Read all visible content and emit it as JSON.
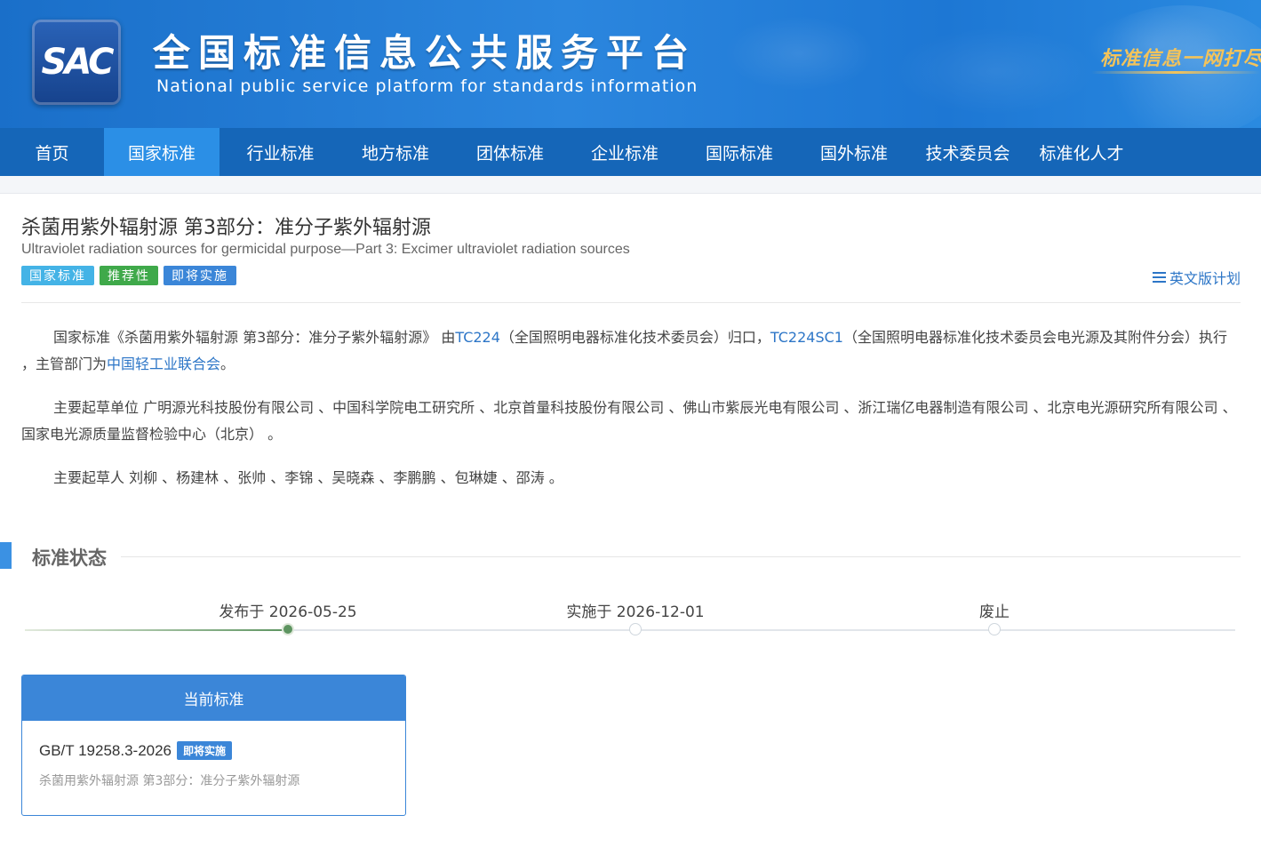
{
  "header": {
    "logo_text": "SAC",
    "title_cn": "全国标准信息公共服务平台",
    "title_en": "National public service platform  for standards information",
    "slogan": "标准信息一网打尽"
  },
  "nav": {
    "items": [
      {
        "label": "首页",
        "active": false
      },
      {
        "label": "国家标准",
        "active": true
      },
      {
        "label": "行业标准",
        "active": false
      },
      {
        "label": "地方标准",
        "active": false
      },
      {
        "label": "团体标准",
        "active": false
      },
      {
        "label": "企业标准",
        "active": false
      },
      {
        "label": "国际标准",
        "active": false
      },
      {
        "label": "国外标准",
        "active": false
      },
      {
        "label": "技术委员会",
        "active": false
      },
      {
        "label": "标准化人才",
        "active": false
      }
    ]
  },
  "standard": {
    "title_cn": "杀菌用紫外辐射源 第3部分：准分子紫外辐射源",
    "title_en": "Ultraviolet radiation sources for germicidal purpose—Part 3: Excimer ultraviolet radiation sources",
    "tags": [
      "国家标准",
      "推荐性",
      "即将实施"
    ],
    "en_plan_label": "英文版计划"
  },
  "description": {
    "p1_a": "国家标准《杀菌用紫外辐射源 第3部分：准分子紫外辐射源》 由",
    "p1_tc": "TC224",
    "p1_b": "（全国照明电器标准化技术委员会）归口，",
    "p1_sc": "TC224SC1",
    "p1_c": "（全国照明电器标准化技术委员会电光源及其附件分会）执行 ，主管部门为",
    "p1_dept": "中国轻工业联合会",
    "p1_end": "。",
    "p2": "主要起草单位 广明源光科技股份有限公司 、中国科学院电工研究所 、北京首量科技股份有限公司 、佛山市紫辰光电有限公司 、浙江瑞亿电器制造有限公司 、北京电光源研究所有限公司 、国家电光源质量监督检验中心（北京） 。",
    "p3": "主要起草人 刘柳 、杨建林 、张帅 、李锦 、吴晓森 、李鹏鹏 、包琳婕 、邵涛 。"
  },
  "status": {
    "section_title": "标准状态",
    "steps": [
      {
        "label": "发布于 2026-05-25",
        "done": true
      },
      {
        "label": "实施于 2026-12-01",
        "done": false
      },
      {
        "label": "废止",
        "done": false
      }
    ]
  },
  "current": {
    "header": "当前标准",
    "code": "GB/T 19258.3-2026",
    "badge": "即将实施",
    "name": "杀菌用紫外辐射源 第3部分：准分子紫外辐射源"
  },
  "colors": {
    "nav_bg": "#1566b8",
    "nav_active": "#2b8fe6",
    "link": "#2d76c7",
    "done": "#5d9460"
  }
}
